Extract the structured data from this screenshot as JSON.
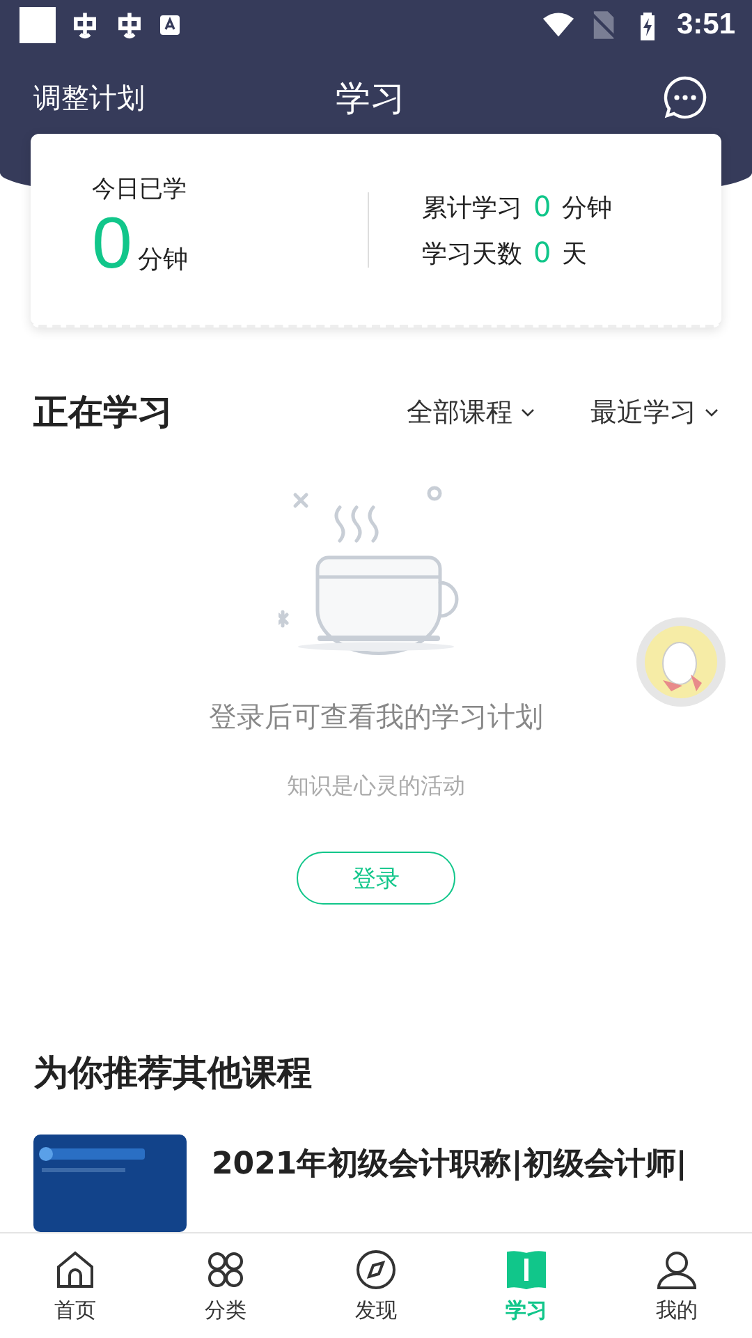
{
  "status_bar": {
    "time": "3:51"
  },
  "header": {
    "left_action": "调整计划",
    "title": "学习"
  },
  "today": {
    "label": "今日已学",
    "value": "0",
    "unit": "分钟"
  },
  "stats": [
    {
      "label": "累计学习",
      "value": "0",
      "unit": "分钟"
    },
    {
      "label": "学习天数",
      "value": "0",
      "unit": "天"
    }
  ],
  "studying": {
    "title": "正在学习",
    "filters": [
      "全部课程",
      "最近学习"
    ]
  },
  "empty_state": {
    "message": "登录后可查看我的学习计划",
    "hint": "知识是心灵的活动",
    "login_button": "登录"
  },
  "recommend": {
    "title": "为你推荐其他课程",
    "courses": [
      {
        "title": "2021年初级会计职称|初级会计师|"
      }
    ]
  },
  "tab_bar": [
    {
      "label": "首页",
      "kind": "home",
      "selected": false
    },
    {
      "label": "分类",
      "kind": "grid",
      "selected": false
    },
    {
      "label": "发现",
      "kind": "compass",
      "selected": false
    },
    {
      "label": "学习",
      "kind": "book",
      "selected": true
    },
    {
      "label": "我的",
      "kind": "person",
      "selected": false
    }
  ]
}
